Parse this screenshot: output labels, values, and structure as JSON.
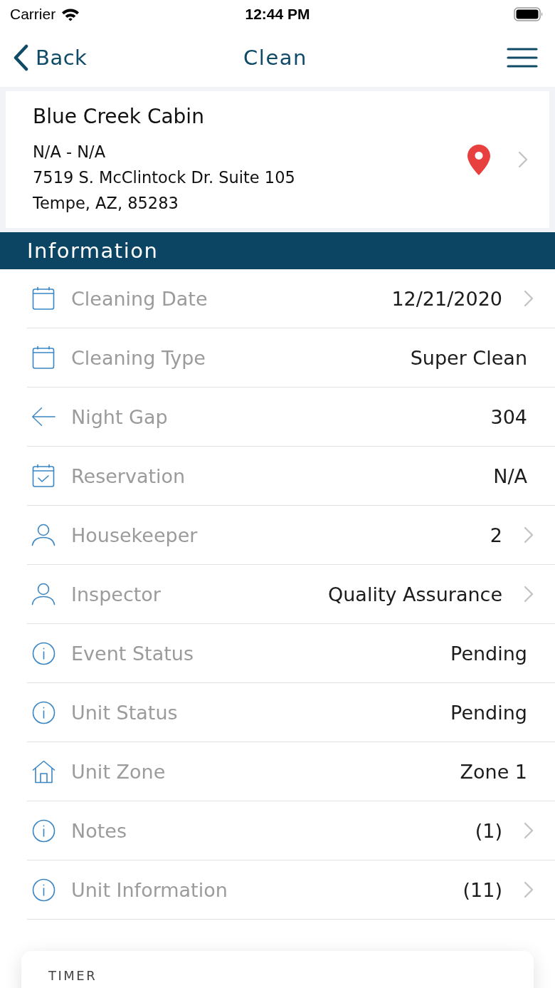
{
  "status_bar": {
    "carrier": "Carrier",
    "time": "12:44 PM"
  },
  "nav": {
    "back": "Back",
    "title": "Clean"
  },
  "property": {
    "name": "Blue Creek Cabin",
    "lines": [
      "N/A - N/A",
      "7519 S. McClintock Dr. Suite 105",
      "Tempe, AZ, 85283"
    ]
  },
  "section": {
    "title": "Information"
  },
  "rows": [
    {
      "kind": "calendar",
      "label": "Cleaning Date",
      "value": "12/21/2020",
      "chevron": true
    },
    {
      "kind": "calendar",
      "label": "Cleaning Type",
      "value": "Super Clean",
      "chevron": false
    },
    {
      "kind": "arrow",
      "label": "Night Gap",
      "value": "304",
      "chevron": false
    },
    {
      "kind": "calendar-check",
      "label": "Reservation",
      "value": "N/A",
      "chevron": false
    },
    {
      "kind": "person",
      "label": "Housekeeper",
      "value": "2",
      "chevron": true
    },
    {
      "kind": "person",
      "label": "Inspector",
      "value": "Quality Assurance",
      "chevron": true
    },
    {
      "kind": "info",
      "label": "Event Status",
      "value": "Pending",
      "chevron": false
    },
    {
      "kind": "info",
      "label": "Unit Status",
      "value": "Pending",
      "chevron": false
    },
    {
      "kind": "house",
      "label": "Unit Zone",
      "value": "Zone 1",
      "chevron": false
    },
    {
      "kind": "info",
      "label": "Notes",
      "value": "(1)",
      "chevron": true
    },
    {
      "kind": "info",
      "label": "Unit Information",
      "value": "(11)",
      "chevron": true
    }
  ],
  "timer": {
    "title": "TIMER"
  }
}
